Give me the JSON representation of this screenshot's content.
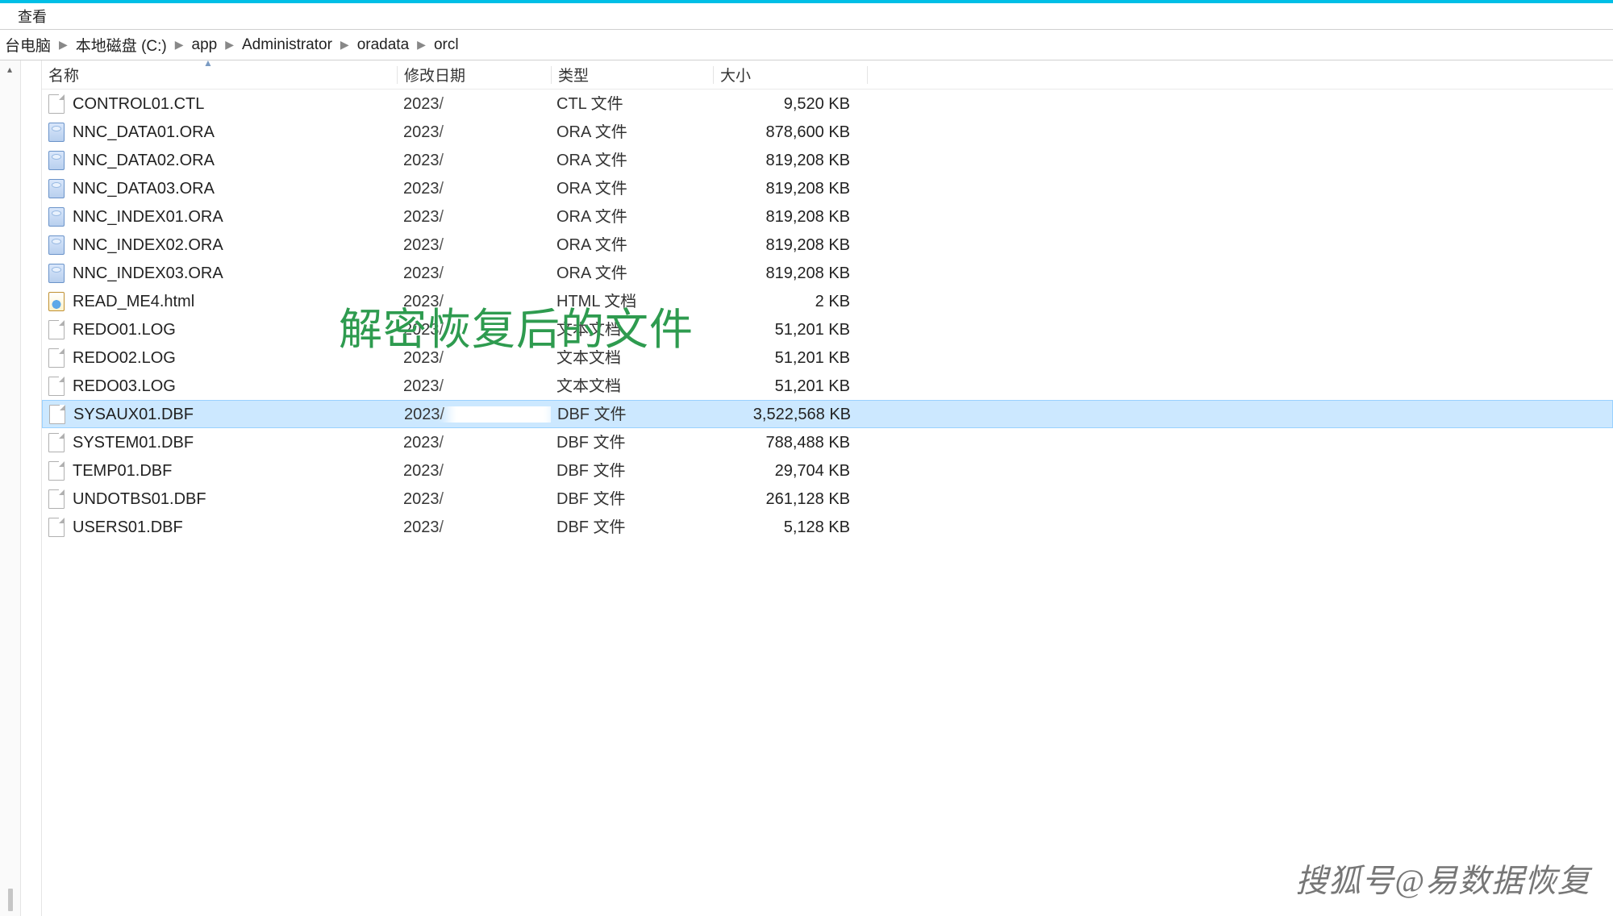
{
  "menu": {
    "view": "查看"
  },
  "breadcrumb": [
    "台电脑",
    "本地磁盘 (C:)",
    "app",
    "Administrator",
    "oradata",
    "orcl"
  ],
  "columns": {
    "name": "名称",
    "date": "修改日期",
    "type": "类型",
    "size": "大小"
  },
  "overlay_text": "解密恢复后的文件",
  "watermark": "搜狐号@易数据恢复",
  "selected_index": 11,
  "files": [
    {
      "icon": "file",
      "name": "CONTROL01.CTL",
      "date": "2023/",
      "type": "CTL 文件",
      "size": "9,520 KB"
    },
    {
      "icon": "db",
      "name": "NNC_DATA01.ORA",
      "date": "2023/",
      "type": "ORA 文件",
      "size": "878,600 KB"
    },
    {
      "icon": "db",
      "name": "NNC_DATA02.ORA",
      "date": "2023/",
      "type": "ORA 文件",
      "size": "819,208 KB"
    },
    {
      "icon": "db",
      "name": "NNC_DATA03.ORA",
      "date": "2023/",
      "type": "ORA 文件",
      "size": "819,208 KB"
    },
    {
      "icon": "db",
      "name": "NNC_INDEX01.ORA",
      "date": "2023/",
      "type": "ORA 文件",
      "size": "819,208 KB"
    },
    {
      "icon": "db",
      "name": "NNC_INDEX02.ORA",
      "date": "2023/",
      "type": "ORA 文件",
      "size": "819,208 KB"
    },
    {
      "icon": "db",
      "name": "NNC_INDEX03.ORA",
      "date": "2023/",
      "type": "ORA 文件",
      "size": "819,208 KB"
    },
    {
      "icon": "html",
      "name": "READ_ME4.html",
      "date": "2023/",
      "type": "HTML 文档",
      "size": "2 KB"
    },
    {
      "icon": "file",
      "name": "REDO01.LOG",
      "date": "2023/",
      "type": "文本文档",
      "size": "51,201 KB"
    },
    {
      "icon": "file",
      "name": "REDO02.LOG",
      "date": "2023/",
      "type": "文本文档",
      "size": "51,201 KB"
    },
    {
      "icon": "file",
      "name": "REDO03.LOG",
      "date": "2023/",
      "type": "文本文档",
      "size": "51,201 KB"
    },
    {
      "icon": "file",
      "name": "SYSAUX01.DBF",
      "date": "2023/",
      "type": "DBF 文件",
      "size": "3,522,568 KB"
    },
    {
      "icon": "file",
      "name": "SYSTEM01.DBF",
      "date": "2023/",
      "type": "DBF 文件",
      "size": "788,488 KB"
    },
    {
      "icon": "file",
      "name": "TEMP01.DBF",
      "date": "2023/",
      "type": "DBF 文件",
      "size": "29,704 KB"
    },
    {
      "icon": "file",
      "name": "UNDOTBS01.DBF",
      "date": "2023/",
      "type": "DBF 文件",
      "size": "261,128 KB"
    },
    {
      "icon": "file",
      "name": "USERS01.DBF",
      "date": "2023/",
      "type": "DBF 文件",
      "size": "5,128 KB"
    }
  ]
}
